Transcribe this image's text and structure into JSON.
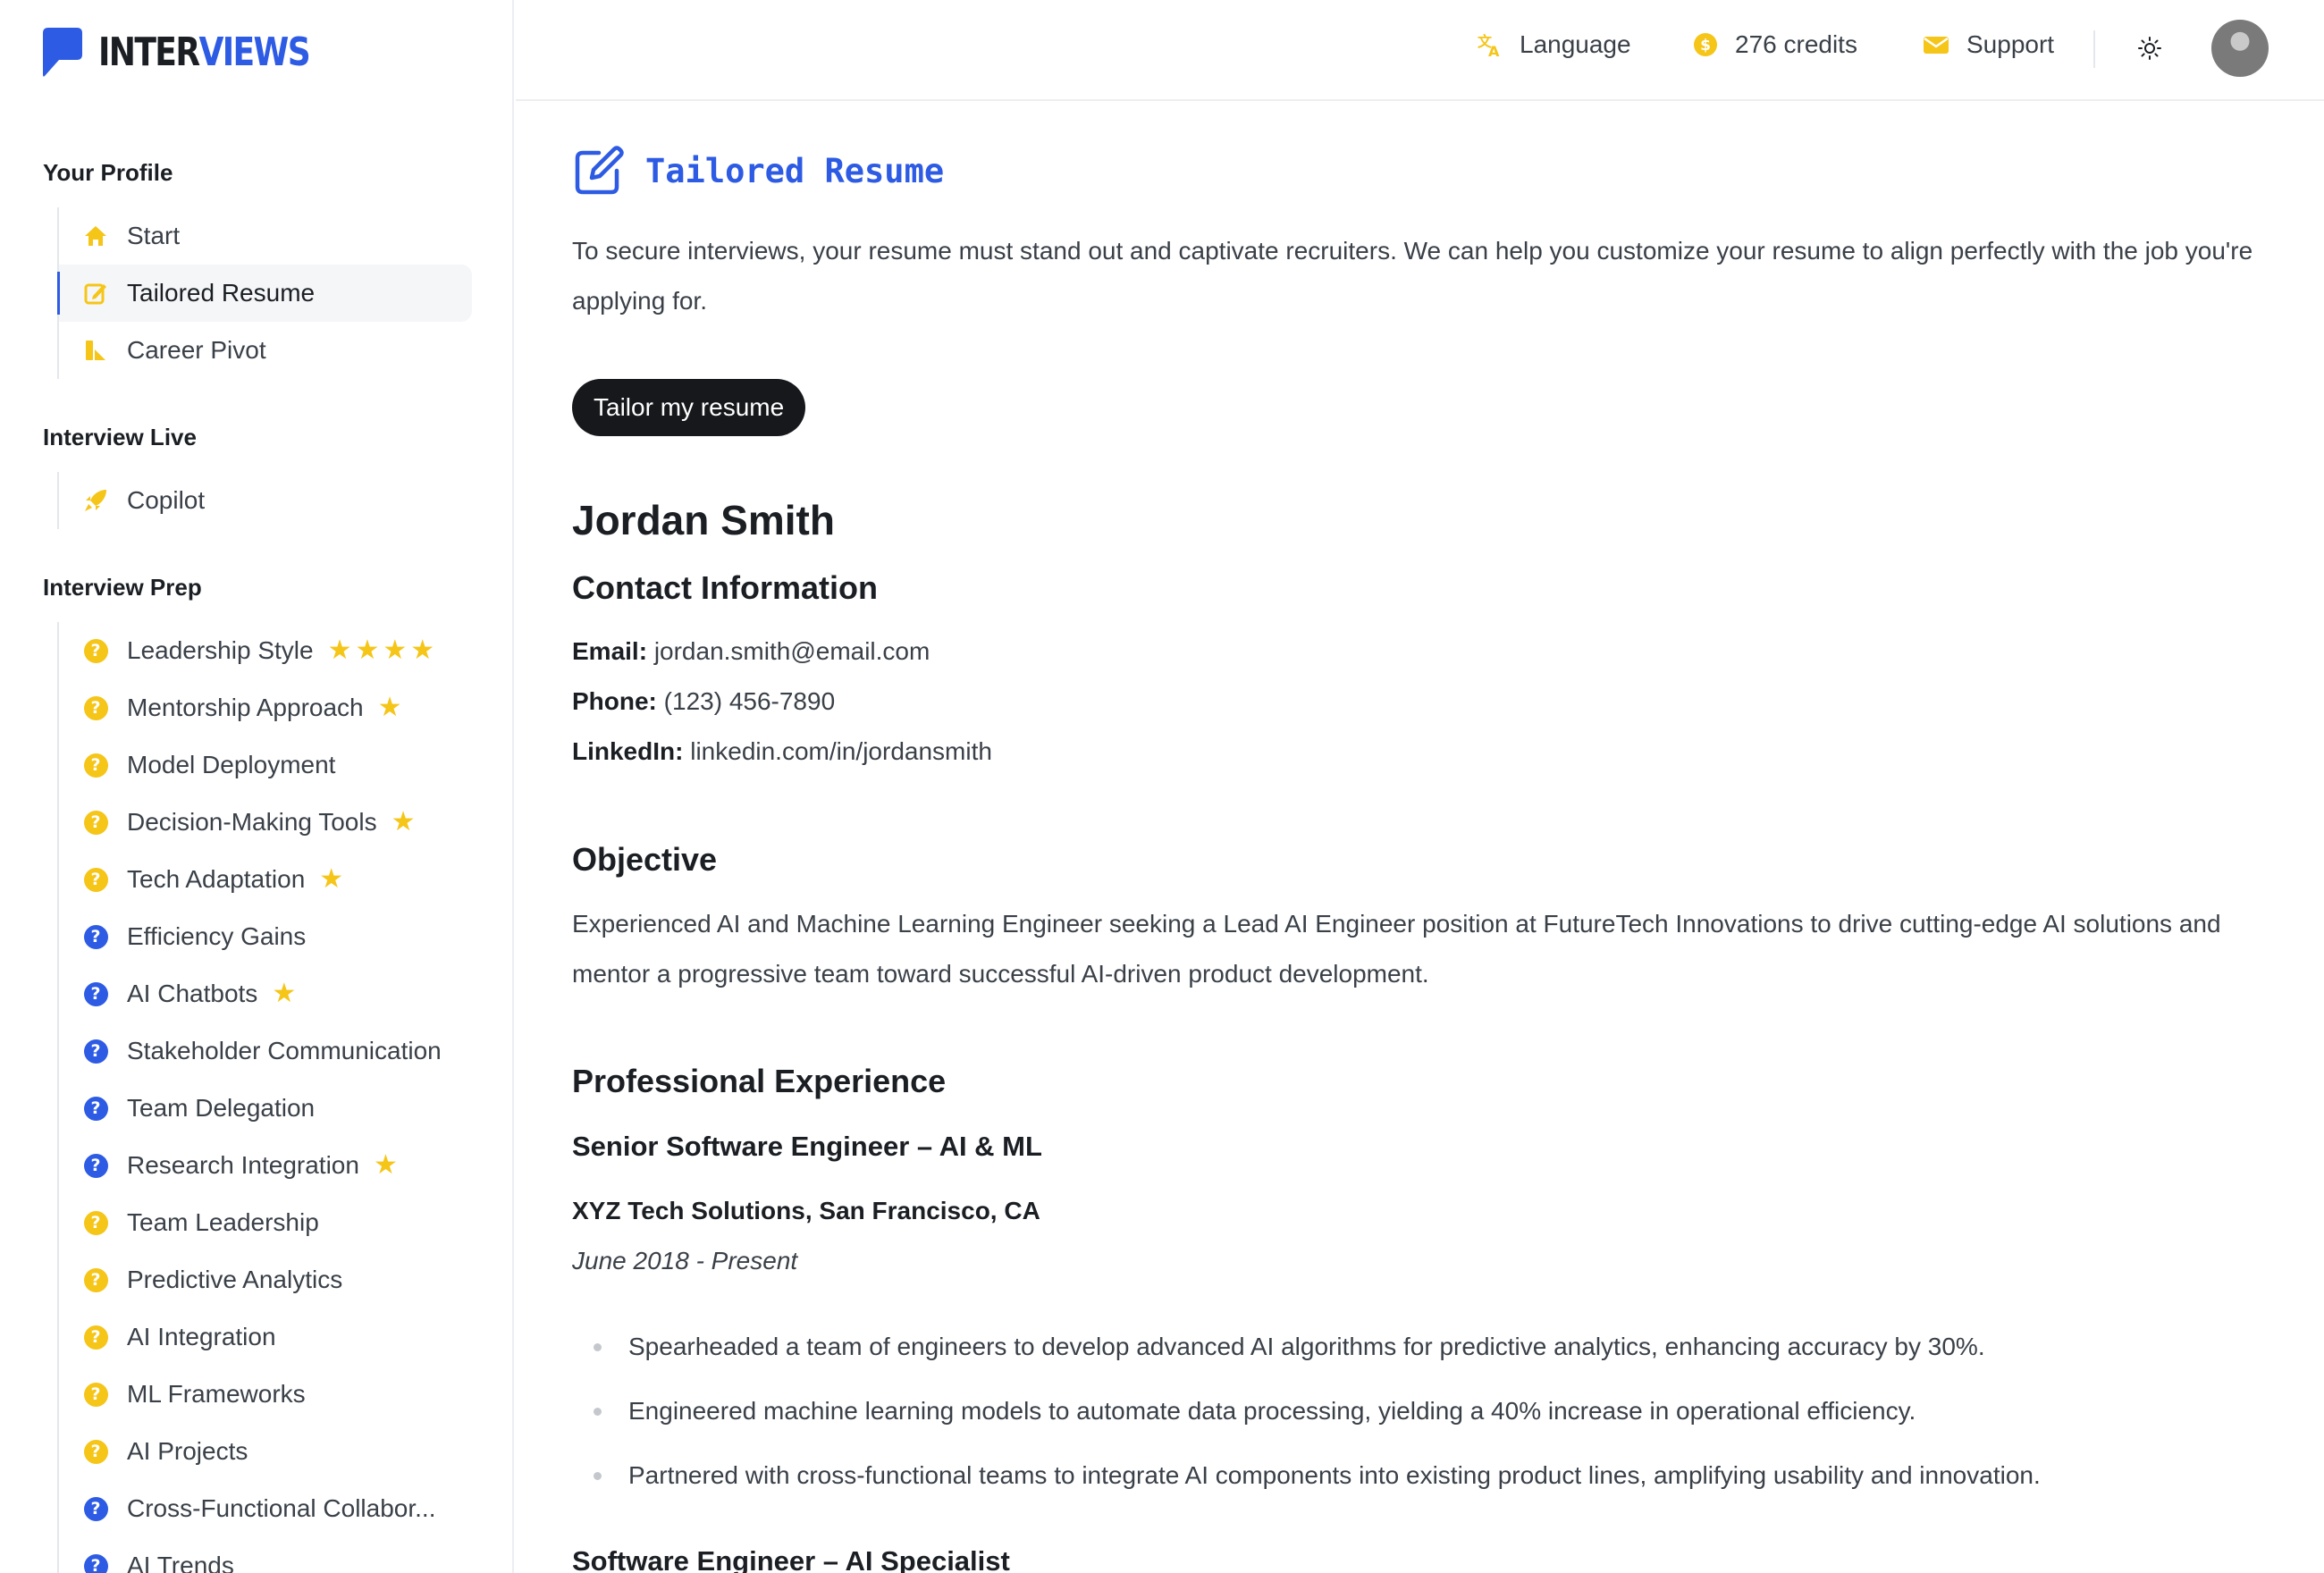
{
  "brand": {
    "word_part1": "INTER",
    "word_part2": "VIEWS",
    "colors": {
      "primary": "#2d5be3",
      "accent": "#f5c518"
    }
  },
  "sidebar": {
    "sections": [
      {
        "title": "Your Profile",
        "items": [
          {
            "label": "Start",
            "icon": "home-icon"
          },
          {
            "label": "Tailored Resume",
            "icon": "edit-icon",
            "active": true
          },
          {
            "label": "Career Pivot",
            "icon": "chart-icon"
          }
        ]
      },
      {
        "title": "Interview Live",
        "items": [
          {
            "label": "Copilot",
            "icon": "rocket-icon"
          }
        ]
      },
      {
        "title": "Interview Prep",
        "items": [
          {
            "label": "Leadership Style",
            "icon": "question-icon",
            "color": "yellow",
            "stars": 4
          },
          {
            "label": "Mentorship Approach",
            "icon": "question-icon",
            "color": "yellow",
            "stars": 1
          },
          {
            "label": "Model Deployment",
            "icon": "question-icon",
            "color": "yellow",
            "stars": 0
          },
          {
            "label": "Decision-Making Tools",
            "icon": "question-icon",
            "color": "yellow",
            "stars": 1
          },
          {
            "label": "Tech Adaptation",
            "icon": "question-icon",
            "color": "yellow",
            "stars": 1
          },
          {
            "label": "Efficiency Gains",
            "icon": "question-icon",
            "color": "blue",
            "stars": 0
          },
          {
            "label": "AI Chatbots",
            "icon": "question-icon",
            "color": "blue",
            "stars": 1
          },
          {
            "label": "Stakeholder Communication",
            "icon": "question-icon",
            "color": "blue",
            "stars": 0
          },
          {
            "label": "Team Delegation",
            "icon": "question-icon",
            "color": "blue",
            "stars": 0
          },
          {
            "label": "Research Integration",
            "icon": "question-icon",
            "color": "blue",
            "stars": 1
          },
          {
            "label": "Team Leadership",
            "icon": "question-icon",
            "color": "yellow",
            "stars": 0
          },
          {
            "label": "Predictive Analytics",
            "icon": "question-icon",
            "color": "yellow",
            "stars": 0
          },
          {
            "label": "AI Integration",
            "icon": "question-icon",
            "color": "yellow",
            "stars": 0
          },
          {
            "label": "ML Frameworks",
            "icon": "question-icon",
            "color": "yellow",
            "stars": 0
          },
          {
            "label": "AI Projects",
            "icon": "question-icon",
            "color": "yellow",
            "stars": 0
          },
          {
            "label": "Cross-Functional Collabor...",
            "icon": "question-icon",
            "color": "blue",
            "stars": 0
          },
          {
            "label": "AI Trends",
            "icon": "question-icon",
            "color": "blue",
            "stars": 0
          }
        ]
      }
    ]
  },
  "header": {
    "language_label": "Language",
    "credits_label": "276 credits",
    "support_label": "Support"
  },
  "main": {
    "title": "Tailored Resume",
    "intro": "To secure interviews, your resume must stand out and captivate recruiters. We can help you customize your resume to align perfectly with the job you're applying for.",
    "cta_label": "Tailor my resume",
    "resume": {
      "name": "Jordan Smith",
      "contact_heading": "Contact Information",
      "email_label": "Email:",
      "email": "jordan.smith@email.com",
      "phone_label": "Phone:",
      "phone": "(123) 456-7890",
      "linkedin_label": "LinkedIn:",
      "linkedin": "linkedin.com/in/jordansmith",
      "objective_heading": "Objective",
      "objective": "Experienced AI and Machine Learning Engineer seeking a Lead AI Engineer position at FutureTech Innovations to drive cutting-edge AI solutions and mentor a progressive team toward successful AI-driven product development.",
      "experience_heading": "Professional Experience",
      "jobs": [
        {
          "title": "Senior Software Engineer – AI & ML",
          "company": "XYZ Tech Solutions, San Francisco, CA",
          "dates": "June 2018 - Present",
          "bullets": [
            "Spearheaded a team of engineers to develop advanced AI algorithms for predictive analytics, enhancing accuracy by 30%.",
            "Engineered machine learning models to automate data processing, yielding a 40% increase in operational efficiency.",
            "Partnered with cross-functional teams to integrate AI components into existing product lines, amplifying usability and innovation."
          ]
        },
        {
          "title": "Software Engineer – AI Specialist"
        }
      ]
    }
  }
}
